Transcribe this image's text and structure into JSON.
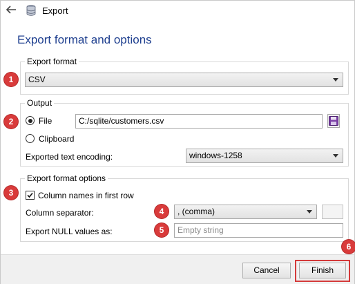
{
  "window": {
    "title": "Export"
  },
  "heading": "Export format and options",
  "badges": [
    "1",
    "2",
    "3",
    "4",
    "5",
    "6"
  ],
  "export_format": {
    "group_label": "Export format",
    "selected": "CSV"
  },
  "output": {
    "group_label": "Output",
    "file_label": "File",
    "file_path": "C:/sqlite/customers.csv",
    "clipboard_label": "Clipboard",
    "encoding_label": "Exported text encoding:",
    "encoding_value": "windows-1258",
    "file_checked": true,
    "clipboard_checked": false
  },
  "format_options": {
    "group_label": "Export format options",
    "column_names_label": "Column names in first row",
    "column_names_checked": true,
    "separator_label": "Column separator:",
    "separator_value": ", (comma)",
    "null_label": "Export NULL values as:",
    "null_placeholder": "Empty string"
  },
  "footer": {
    "cancel_label": "Cancel",
    "finish_label": "Finish"
  },
  "colors": {
    "heading": "#1e3f8f",
    "badge": "#d93b3b",
    "highlight": "#d43a3a"
  },
  "icons": {
    "back": "back-arrow-icon",
    "app": "database-icon",
    "save": "floppy-disk-icon"
  }
}
